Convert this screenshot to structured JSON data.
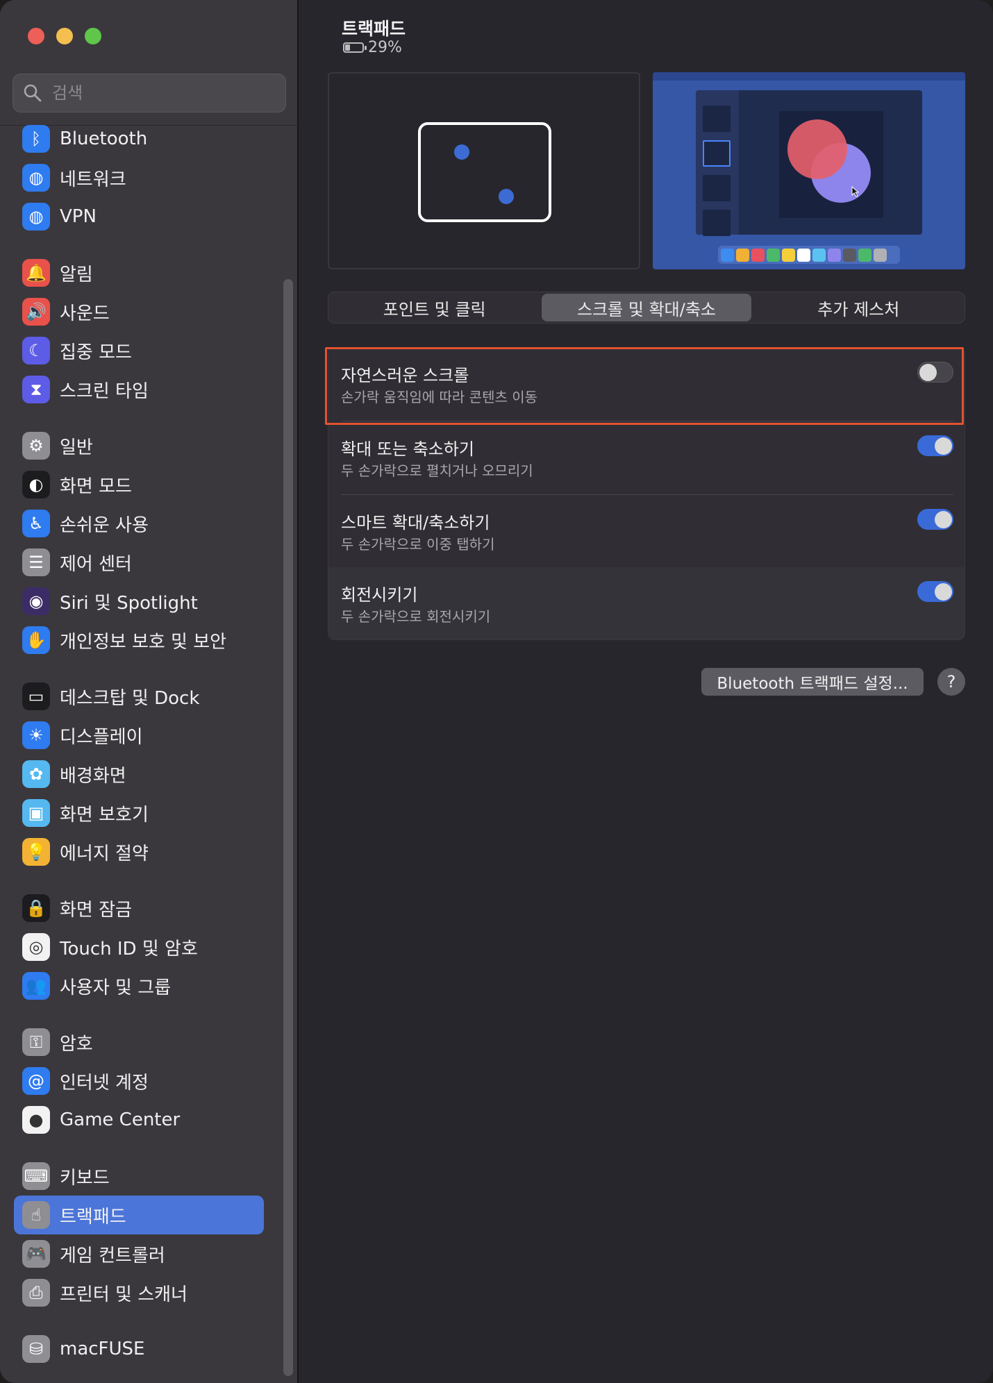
{
  "window": {
    "traffic_lights": [
      "close",
      "minimize",
      "zoom"
    ]
  },
  "sidebar": {
    "search_placeholder": "검색",
    "items": [
      {
        "label": "Bluetooth",
        "icon": "bluetooth-icon",
        "color": "#2f7bf0",
        "glyph": "ᛒ"
      },
      {
        "label": "네트워크",
        "icon": "globe-icon",
        "color": "#2f7bf0",
        "glyph": "◍"
      },
      {
        "label": "VPN",
        "icon": "vpn-globe-icon",
        "color": "#2f7bf0",
        "glyph": "◍"
      },
      {
        "label": "알림",
        "icon": "bell-icon",
        "color": "#e9514b",
        "glyph": "🔔"
      },
      {
        "label": "사운드",
        "icon": "speaker-icon",
        "color": "#e9514b",
        "glyph": "🔊"
      },
      {
        "label": "집중 모드",
        "icon": "moon-icon",
        "color": "#5d5ce6",
        "glyph": "☾"
      },
      {
        "label": "스크린 타임",
        "icon": "hourglass-icon",
        "color": "#5d5ce6",
        "glyph": "⧗"
      },
      {
        "label": "일반",
        "icon": "gear-icon",
        "color": "#8e8e93",
        "glyph": "⚙"
      },
      {
        "label": "화면 모드",
        "icon": "appearance-icon",
        "color": "#1c1c1e",
        "glyph": "◐"
      },
      {
        "label": "손쉬운 사용",
        "icon": "accessibility-icon",
        "color": "#2f7bf0",
        "glyph": "♿"
      },
      {
        "label": "제어 센터",
        "icon": "toggles-icon",
        "color": "#8e8e93",
        "glyph": "☰"
      },
      {
        "label": "Siri 및 Spotlight",
        "icon": "siri-icon",
        "color": "#3c2c66",
        "glyph": "◉"
      },
      {
        "label": "개인정보 보호 및 보안",
        "icon": "hand-icon",
        "color": "#2f7bf0",
        "glyph": "✋"
      },
      {
        "label": "데스크탑 및 Dock",
        "icon": "dock-icon",
        "color": "#1c1c1e",
        "glyph": "▭"
      },
      {
        "label": "디스플레이",
        "icon": "sun-icon",
        "color": "#2f7bf0",
        "glyph": "☀"
      },
      {
        "label": "배경화면",
        "icon": "flower-icon",
        "color": "#55b8f0",
        "glyph": "✿"
      },
      {
        "label": "화면 보호기",
        "icon": "screensaver-icon",
        "color": "#55b8f0",
        "glyph": "▣"
      },
      {
        "label": "에너지 절약",
        "icon": "lightbulb-icon",
        "color": "#f3b233",
        "glyph": "💡"
      },
      {
        "label": "화면 잠금",
        "icon": "lock-icon",
        "color": "#1c1c1e",
        "glyph": "🔒"
      },
      {
        "label": "Touch ID 및 암호",
        "icon": "fingerprint-icon",
        "color": "#f2f2f2",
        "glyph": "◎"
      },
      {
        "label": "사용자 및 그룹",
        "icon": "users-icon",
        "color": "#2f7bf0",
        "glyph": "👥"
      },
      {
        "label": "암호",
        "icon": "key-icon",
        "color": "#8e8e93",
        "glyph": "⚿"
      },
      {
        "label": "인터넷 계정",
        "icon": "at-icon",
        "color": "#2f7bf0",
        "glyph": "@"
      },
      {
        "label": "Game Center",
        "icon": "game-center-icon",
        "color": "#f2f2f2",
        "glyph": "●"
      },
      {
        "label": "키보드",
        "icon": "keyboard-icon",
        "color": "#8e8e93",
        "glyph": "⌨"
      },
      {
        "label": "트랙패드",
        "icon": "trackpad-icon",
        "color": "#8e8e93",
        "glyph": "☝"
      },
      {
        "label": "게임 컨트롤러",
        "icon": "gamepad-icon",
        "color": "#8e8e93",
        "glyph": "🎮"
      },
      {
        "label": "프린터 및 스캐너",
        "icon": "printer-icon",
        "color": "#8e8e93",
        "glyph": "⎙"
      },
      {
        "label": "macFUSE",
        "icon": "macfuse-icon",
        "color": "#8e8e93",
        "glyph": "⛁"
      }
    ],
    "active_item": "트랙패드"
  },
  "header": {
    "title": "트랙패드",
    "battery_percent": "29%",
    "battery_level": 0.29
  },
  "tabs": [
    {
      "label": "포인트 및 클릭",
      "active": false
    },
    {
      "label": "스크롤 및 확대/축소",
      "active": true
    },
    {
      "label": "추가 제스처",
      "active": false
    }
  ],
  "settings": [
    {
      "title": "자연스러운 스크롤",
      "description": "손가락 움직임에 따라 콘텐츠 이동",
      "enabled": false
    },
    {
      "title": "확대 또는 축소하기",
      "description": "두 손가락으로 펼치거나 오므리기",
      "enabled": true
    },
    {
      "title": "스마트 확대/축소하기",
      "description": "두 손가락으로 이중 탭하기",
      "enabled": true
    },
    {
      "title": "회전시키기",
      "description": "두 손가락으로 회전시키기",
      "enabled": true
    }
  ],
  "buttons": {
    "bluetooth_setup": "Bluetooth 트랙패드 설정...",
    "help": "?"
  },
  "colors": {
    "accent": "#4c75d9",
    "toggle_on": "#3a6ad8",
    "highlight": "#e4522f"
  }
}
